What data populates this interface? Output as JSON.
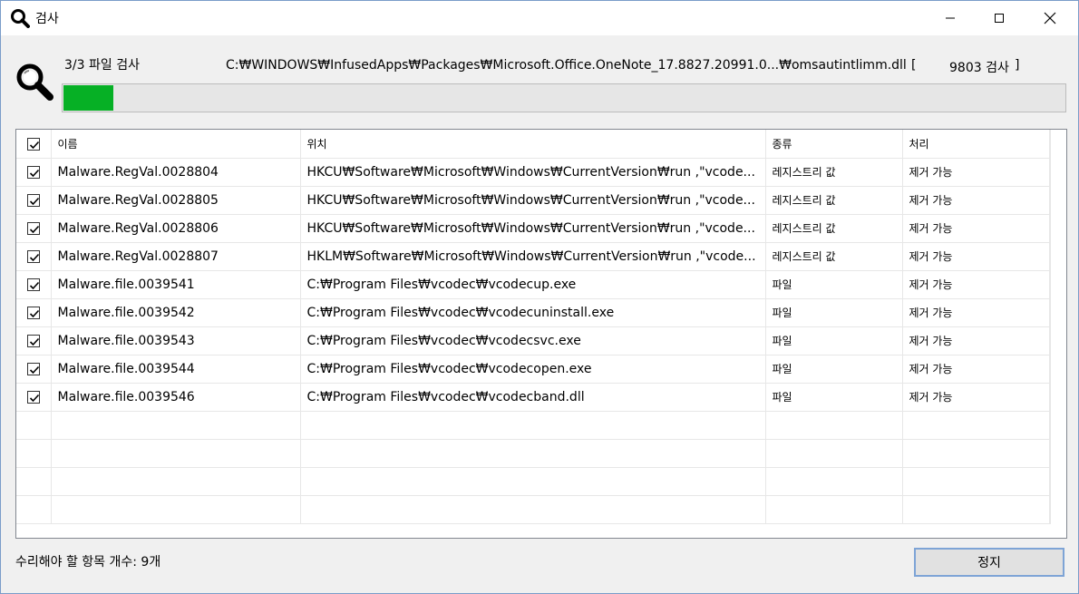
{
  "window": {
    "title": "검사",
    "title_icon": "search-icon"
  },
  "scan": {
    "count_text": "3/3 파일 검사",
    "current_path": "C:₩WINDOWS₩InfusedApps₩Packages₩Microsoft.Office.OneNote_17.8827.20991.0...₩omsautintlimm.dll",
    "bracket_open": "[",
    "scanned_num": "9803 검사",
    "bracket_close": "]",
    "progress_fraction": 0.05,
    "progress_color": "#06b025"
  },
  "table": {
    "header_checked": true,
    "columns": [
      "이름",
      "위치",
      "종류",
      "처리"
    ],
    "rows": [
      {
        "checked": true,
        "name": "Malware.RegVal.0028804",
        "location": "HKCU₩Software₩Microsoft₩Windows₩CurrentVersion₩run ,\"vcode...",
        "type": "레지스트리 값",
        "action": "제거 가능"
      },
      {
        "checked": true,
        "name": "Malware.RegVal.0028805",
        "location": "HKCU₩Software₩Microsoft₩Windows₩CurrentVersion₩run ,\"vcode...",
        "type": "레지스트리 값",
        "action": "제거 가능"
      },
      {
        "checked": true,
        "name": "Malware.RegVal.0028806",
        "location": "HKCU₩Software₩Microsoft₩Windows₩CurrentVersion₩run ,\"vcode...",
        "type": "레지스트리 값",
        "action": "제거 가능"
      },
      {
        "checked": true,
        "name": "Malware.RegVal.0028807",
        "location": "HKLM₩Software₩Microsoft₩Windows₩CurrentVersion₩run ,\"vcode...",
        "type": "레지스트리 값",
        "action": "제거 가능"
      },
      {
        "checked": true,
        "name": "Malware.file.0039541",
        "location": "C:₩Program Files₩vcodec₩vcodecup.exe",
        "type": "파일",
        "action": "제거 가능"
      },
      {
        "checked": true,
        "name": "Malware.file.0039542",
        "location": "C:₩Program Files₩vcodec₩vcodecuninstall.exe",
        "type": "파일",
        "action": "제거 가능"
      },
      {
        "checked": true,
        "name": "Malware.file.0039543",
        "location": "C:₩Program Files₩vcodec₩vcodecsvc.exe",
        "type": "파일",
        "action": "제거 가능"
      },
      {
        "checked": true,
        "name": "Malware.file.0039544",
        "location": "C:₩Program Files₩vcodec₩vcodecopen.exe",
        "type": "파일",
        "action": "제거 가능"
      },
      {
        "checked": true,
        "name": "Malware.file.0039546",
        "location": "C:₩Program Files₩vcodec₩vcodecband.dll",
        "type": "파일",
        "action": "제거 가능"
      }
    ]
  },
  "footer": {
    "item_count_text": "수리해야 할 항목 개수: 9개",
    "stop_label": "정지"
  }
}
